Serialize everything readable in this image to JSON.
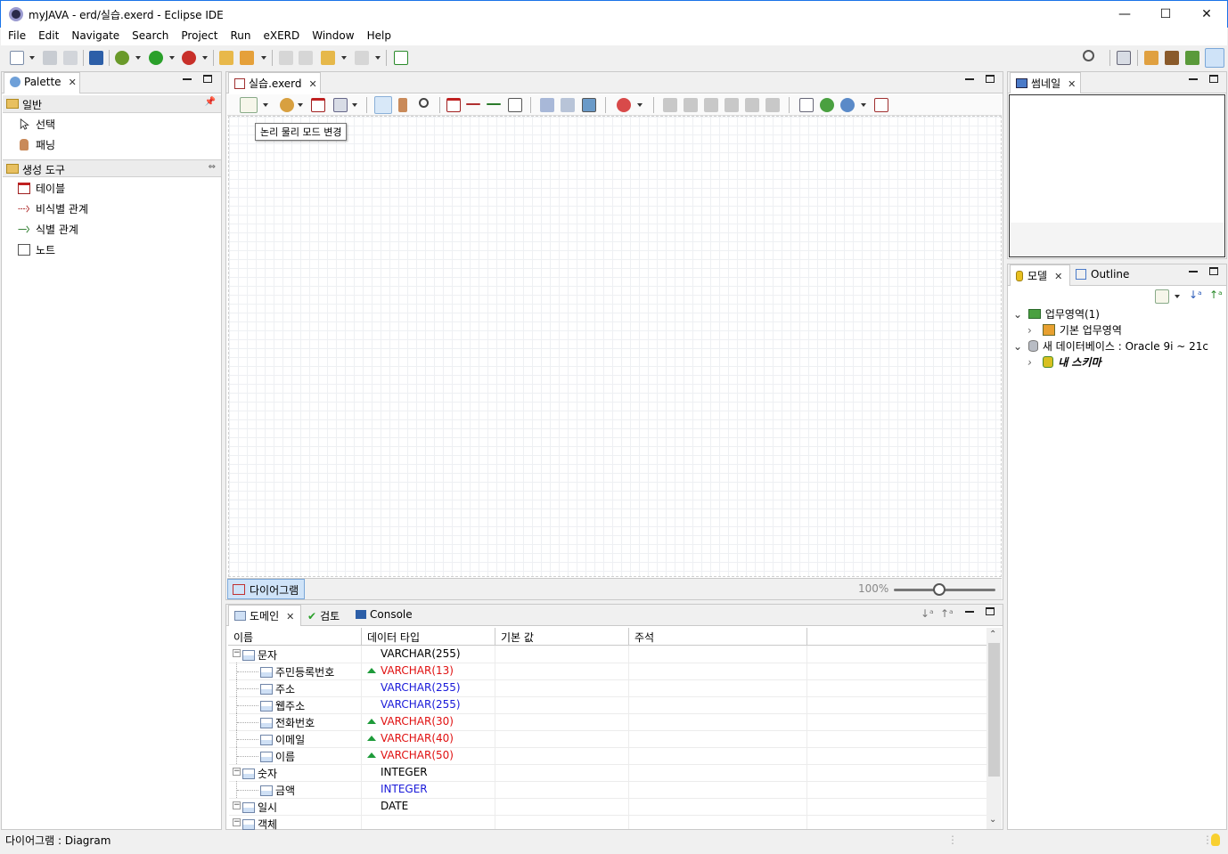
{
  "window": {
    "title": "myJAVA - erd/실습.exerd - Eclipse IDE",
    "minimize": "—",
    "maximize": "☐",
    "close": "✕"
  },
  "menu": [
    "File",
    "Edit",
    "Navigate",
    "Search",
    "Project",
    "Run",
    "eXERD",
    "Window",
    "Help"
  ],
  "palette": {
    "tab_label": "Palette",
    "groups": [
      {
        "label": "일반",
        "items": [
          "선택",
          "패닝"
        ]
      },
      {
        "label": "생성 도구",
        "items": [
          "테이블",
          "비식별 관계",
          "식별 관계",
          "노트"
        ]
      }
    ]
  },
  "editor": {
    "tab_label": "실습.exerd",
    "tooltip": "논리 물리 모드 변경",
    "bottom_tab": "다이어그램",
    "zoom_label": "100%",
    "zoom_level": 0.45
  },
  "thumbnail": {
    "tab_label": "썸네일"
  },
  "model": {
    "tab_label": "모델",
    "outline_label": "Outline",
    "tree": [
      {
        "label": "업무영역(1)",
        "expanded": true,
        "level": 0
      },
      {
        "label": "기본 업무영역",
        "expanded": false,
        "level": 1
      },
      {
        "label": "새 데이터베이스 : Oracle 9i ~ 21c",
        "expanded": true,
        "level": 0
      },
      {
        "label": "내 스키마",
        "expanded": false,
        "level": 1
      }
    ]
  },
  "domain": {
    "tabs": [
      "도메인",
      "검토",
      "Console"
    ],
    "columns": [
      "이름",
      "데이터 타입",
      "기본 값",
      "주석"
    ],
    "rows": [
      {
        "name": "문자",
        "type": "VARCHAR(255)",
        "level": 0,
        "color": "black",
        "changed": false
      },
      {
        "name": "주민등록번호",
        "type": "VARCHAR(13)",
        "level": 1,
        "color": "red",
        "changed": true
      },
      {
        "name": "주소",
        "type": "VARCHAR(255)",
        "level": 1,
        "color": "blue",
        "changed": false
      },
      {
        "name": "웹주소",
        "type": "VARCHAR(255)",
        "level": 1,
        "color": "blue",
        "changed": false
      },
      {
        "name": "전화번호",
        "type": "VARCHAR(30)",
        "level": 1,
        "color": "red",
        "changed": true
      },
      {
        "name": "이메일",
        "type": "VARCHAR(40)",
        "level": 1,
        "color": "red",
        "changed": true
      },
      {
        "name": "이름",
        "type": "VARCHAR(50)",
        "level": 1,
        "color": "red",
        "changed": true
      },
      {
        "name": "숫자",
        "type": "INTEGER",
        "level": 0,
        "color": "black",
        "changed": false
      },
      {
        "name": "금액",
        "type": "INTEGER",
        "level": 1,
        "color": "blue",
        "changed": false
      },
      {
        "name": "일시",
        "type": "DATE",
        "level": 0,
        "color": "black",
        "changed": false
      },
      {
        "name": "객체",
        "type": "",
        "level": 0,
        "color": "black",
        "changed": false
      }
    ]
  },
  "status": {
    "text": "다이어그램 : Diagram"
  }
}
